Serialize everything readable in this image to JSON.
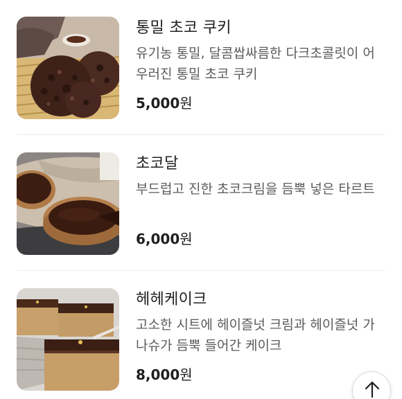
{
  "menu": {
    "items": [
      {
        "name": "통밀 초코 쿠키",
        "description": "유기농 통밀, 달콤쌉싸름한 다크초콜릿이 어우러진 통밀 초코 쿠키",
        "price": "5,000",
        "currency": "원",
        "image_icon": "chocolate-cookie-photo"
      },
      {
        "name": "초코달",
        "description": "부드럽고 진한 초코크림을 듬뿍 넣은 타르트",
        "price": "6,000",
        "currency": "원",
        "image_icon": "chocolate-tart-photo"
      },
      {
        "name": "헤헤케이크",
        "description": "고소한 시트에 헤이즐넛 크림과 헤이즐넛 가나슈가 듬뿍 들어간 케이크",
        "price": "8,000",
        "currency": "원",
        "image_icon": "hazelnut-cake-photo"
      }
    ]
  },
  "scroll_top_button": {
    "icon": "arrow-up-icon"
  }
}
